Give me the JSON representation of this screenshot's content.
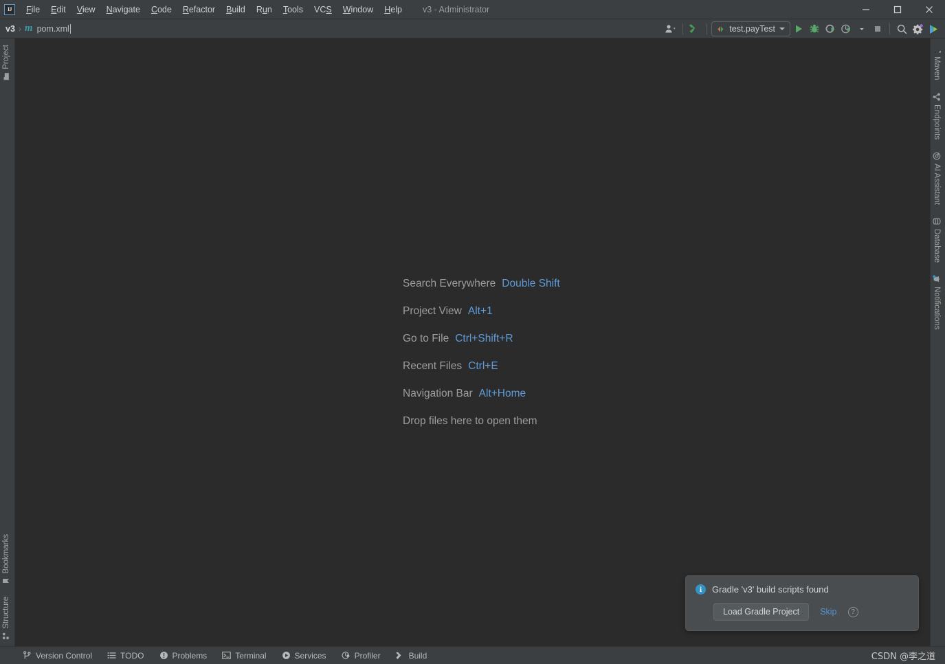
{
  "window": {
    "title": "v3 - Administrator",
    "app_icon": "intellij-logo-icon",
    "controls": {
      "minimize": "minimize-icon",
      "maximize": "maximize-icon",
      "close": "close-icon"
    }
  },
  "menubar": {
    "items": [
      {
        "label": "File",
        "mnemonic": "F"
      },
      {
        "label": "Edit",
        "mnemonic": "E"
      },
      {
        "label": "View",
        "mnemonic": "V"
      },
      {
        "label": "Navigate",
        "mnemonic": "N"
      },
      {
        "label": "Code",
        "mnemonic": "C"
      },
      {
        "label": "Refactor",
        "mnemonic": "R"
      },
      {
        "label": "Build",
        "mnemonic": "B"
      },
      {
        "label": "Run",
        "mnemonic": "u"
      },
      {
        "label": "Tools",
        "mnemonic": "T"
      },
      {
        "label": "VCS",
        "mnemonic": "S"
      },
      {
        "label": "Window",
        "mnemonic": "W"
      },
      {
        "label": "Help",
        "mnemonic": "H"
      }
    ]
  },
  "navbar": {
    "breadcrumb": {
      "project": "v3",
      "separator": "›",
      "file_icon": "maven-m-icon",
      "file": "pom.xml"
    },
    "toolbar": {
      "account": "user-account-icon",
      "build": "build-hammer-icon",
      "run_config": {
        "icon": "run-config-icon",
        "label": "test.payTest",
        "chevron": "chevron-down-icon"
      },
      "run": "run-play-icon",
      "debug": "debug-bug-icon",
      "run_with_coverage": "run-coverage-icon",
      "profiler": "profiler-icon",
      "stop": "stop-icon",
      "search": "search-icon",
      "settings": "settings-gear-icon",
      "ai": "ai-assistant-icon"
    }
  },
  "sidebar_left": {
    "top": [
      {
        "label": "Project",
        "icon": "project-folder-icon"
      }
    ],
    "bottom": [
      {
        "label": "Bookmarks",
        "icon": "bookmark-icon"
      },
      {
        "label": "Structure",
        "icon": "structure-icon"
      }
    ]
  },
  "sidebar_right": {
    "items": [
      {
        "label": "Maven",
        "icon": "maven-m-icon"
      },
      {
        "label": "Endpoints",
        "icon": "endpoints-icon"
      },
      {
        "label": "AI Assistant",
        "icon": "at-sign-icon"
      },
      {
        "label": "Database",
        "icon": "database-icon"
      },
      {
        "label": "Notifications",
        "icon": "notifications-bell-icon"
      }
    ]
  },
  "editor": {
    "tips": [
      {
        "label": "Search Everywhere",
        "shortcut": "Double Shift"
      },
      {
        "label": "Project View",
        "shortcut": "Alt+1"
      },
      {
        "label": "Go to File",
        "shortcut": "Ctrl+Shift+R"
      },
      {
        "label": "Recent Files",
        "shortcut": "Ctrl+E"
      },
      {
        "label": "Navigation Bar",
        "shortcut": "Alt+Home"
      },
      {
        "label": "Drop files here to open them",
        "shortcut": ""
      }
    ]
  },
  "notification": {
    "icon": "info-icon",
    "title": "Gradle 'v3' build scripts found",
    "primary_button": "Load Gradle Project",
    "skip_link": "Skip",
    "help_icon": "help-question-icon"
  },
  "statusbar": {
    "items": [
      {
        "label": "Version Control",
        "icon": "branch-icon"
      },
      {
        "label": "TODO",
        "icon": "todo-list-icon"
      },
      {
        "label": "Problems",
        "icon": "problems-warning-icon"
      },
      {
        "label": "Terminal",
        "icon": "terminal-icon"
      },
      {
        "label": "Services",
        "icon": "services-play-icon"
      },
      {
        "label": "Profiler",
        "icon": "profiler-icon"
      },
      {
        "label": "Build",
        "icon": "build-hammer-icon"
      }
    ],
    "watermark": "CSDN @李之道"
  },
  "colors": {
    "editor_bg": "#2b2b2b",
    "chrome_bg": "#3c3f41",
    "accent_blue": "#5f9bd8",
    "link_blue": "#4f94d4",
    "run_green": "#59a869",
    "text_primary": "#cfcfcf",
    "text_muted": "#9d9d9d",
    "notif_bg": "#4a4d4f"
  }
}
